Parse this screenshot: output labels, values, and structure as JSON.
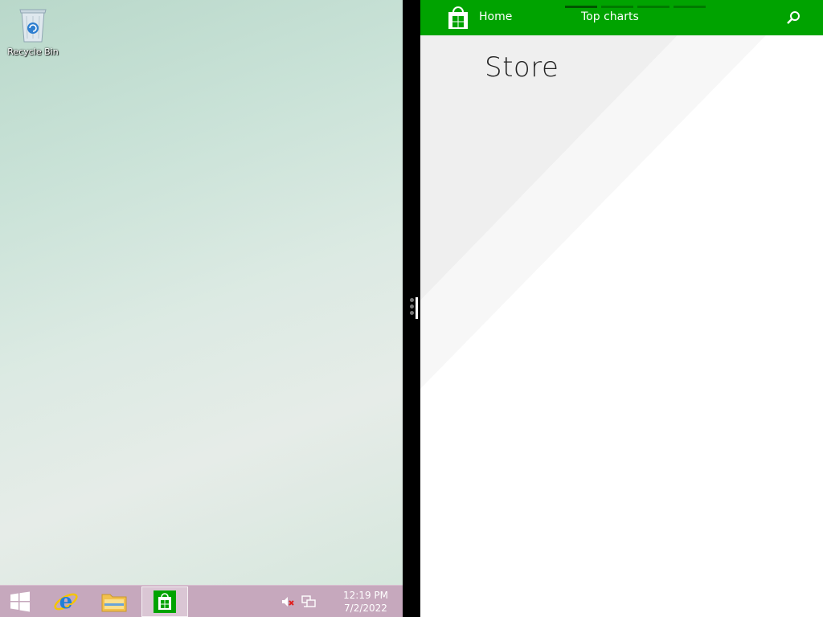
{
  "desktop": {
    "icons": [
      {
        "label": "Recycle Bin",
        "icon": "recycle-bin-icon"
      }
    ]
  },
  "taskbar": {
    "pinned": [
      {
        "name": "start",
        "icon": "windows-logo-icon"
      },
      {
        "name": "internet-explorer",
        "icon": "internet-explorer-icon"
      },
      {
        "name": "file-explorer",
        "icon": "folder-icon"
      },
      {
        "name": "store",
        "icon": "store-bag-icon",
        "active": true
      }
    ],
    "tray_icons": [
      "speaker-muted-icon",
      "network-icon"
    ],
    "clock": {
      "time": "12:19 PM",
      "date": "7/2/2022"
    }
  },
  "store": {
    "nav": {
      "home_label": "Home",
      "top_charts_label": "Top charts"
    },
    "title": "Store",
    "colors": {
      "header": "#00a300",
      "background": "#ffffff",
      "band": "#efefef"
    }
  }
}
